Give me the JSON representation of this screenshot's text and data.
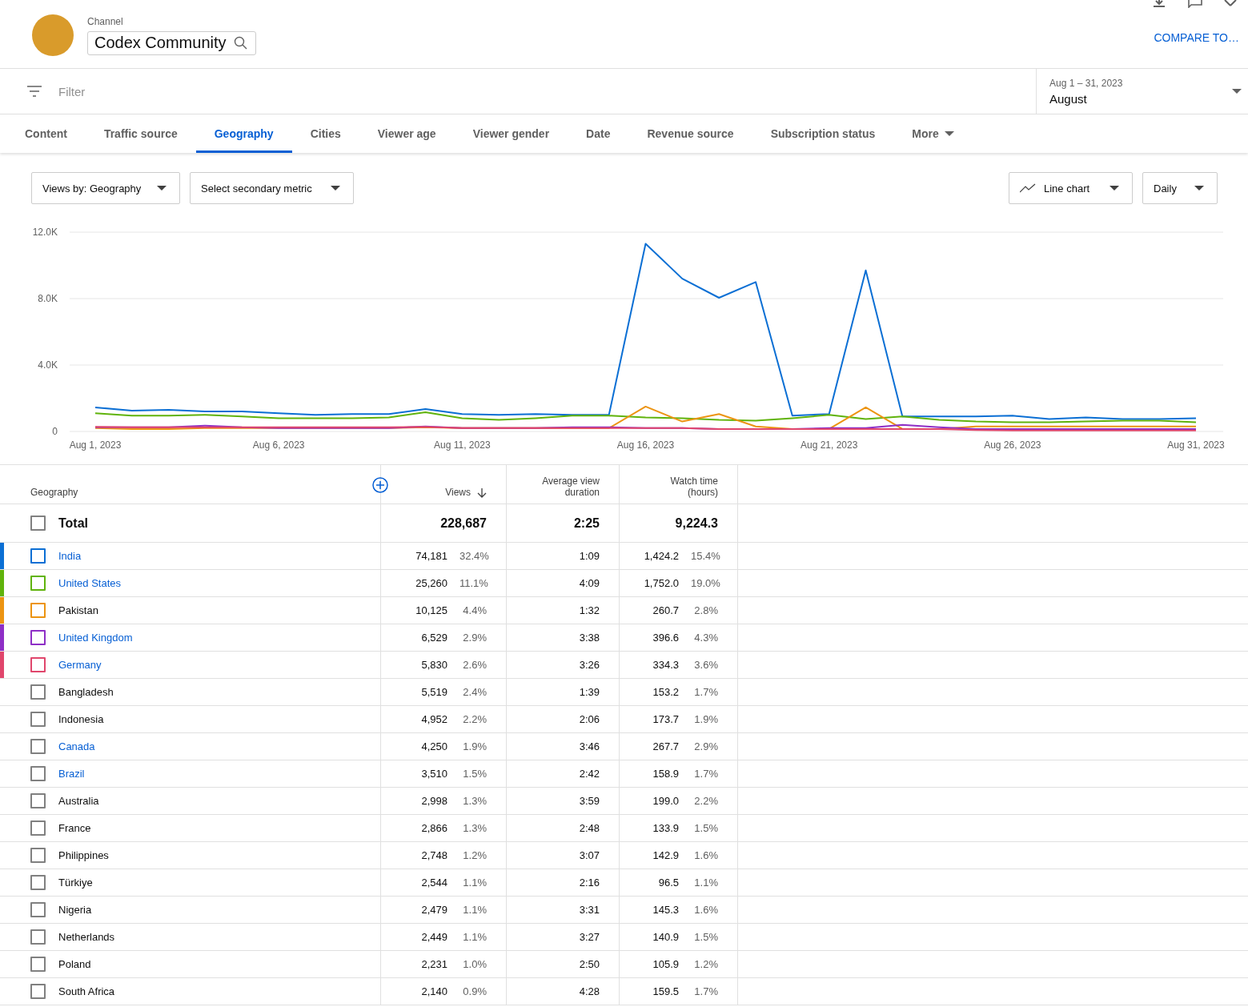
{
  "header": {
    "label": "Channel",
    "channel": "Codex Community",
    "compare": "COMPARE TO…"
  },
  "filter": {
    "placeholder": "Filter"
  },
  "date_range": {
    "range": "Aug 1 – 31, 2023",
    "period": "August"
  },
  "tabs": [
    {
      "label": "Content",
      "selected": false
    },
    {
      "label": "Traffic source",
      "selected": false
    },
    {
      "label": "Geography",
      "selected": true
    },
    {
      "label": "Cities",
      "selected": false
    },
    {
      "label": "Viewer age",
      "selected": false
    },
    {
      "label": "Viewer gender",
      "selected": false
    },
    {
      "label": "Date",
      "selected": false
    },
    {
      "label": "Revenue source",
      "selected": false
    },
    {
      "label": "Subscription status",
      "selected": false
    }
  ],
  "more": "More",
  "controls": {
    "primary": "Views by: Geography",
    "secondary": "Select secondary metric",
    "chart_type": "Line chart",
    "interval": "Daily"
  },
  "chart_data": {
    "type": "line",
    "categories": [
      "Aug 1, 2023",
      null,
      null,
      null,
      null,
      "Aug 6, 2023",
      null,
      null,
      null,
      null,
      "Aug 11, 2023",
      null,
      null,
      null,
      null,
      "Aug 16, 2023",
      null,
      null,
      null,
      null,
      "Aug 21, 2023",
      null,
      null,
      null,
      null,
      "Aug 26, 2023",
      null,
      null,
      null,
      null,
      "Aug 31, 2023"
    ],
    "ylim": [
      0,
      12000
    ],
    "yticks": [
      {
        "value": 0,
        "label": "0"
      },
      {
        "value": 4000,
        "label": "4.0K"
      },
      {
        "value": 8000,
        "label": "8.0K"
      },
      {
        "value": 12000,
        "label": "12.0K"
      }
    ],
    "series": [
      {
        "color": "#0b6fd4",
        "values": [
          1450,
          1250,
          1300,
          1200,
          1200,
          1100,
          1000,
          1050,
          1050,
          1350,
          1050,
          1000,
          1050,
          1000,
          1000,
          11300,
          9200,
          8050,
          9000,
          950,
          1050,
          9700,
          900,
          900,
          900,
          950,
          750,
          850,
          750,
          750,
          800
        ]
      },
      {
        "color": "#60b30c",
        "values": [
          1100,
          950,
          950,
          1000,
          900,
          800,
          800,
          800,
          850,
          1150,
          800,
          700,
          800,
          950,
          950,
          850,
          800,
          700,
          650,
          800,
          1000,
          750,
          900,
          700,
          600,
          550,
          550,
          600,
          650,
          650,
          550
        ]
      },
      {
        "color": "#ec9412",
        "values": [
          200,
          150,
          150,
          200,
          200,
          200,
          200,
          200,
          200,
          250,
          200,
          200,
          200,
          200,
          200,
          1500,
          600,
          1050,
          300,
          150,
          150,
          1450,
          150,
          150,
          300,
          300,
          300,
          300,
          300,
          300,
          300
        ]
      },
      {
        "color": "#8e2fc6",
        "values": [
          250,
          250,
          250,
          350,
          250,
          200,
          200,
          200,
          200,
          300,
          200,
          200,
          200,
          250,
          250,
          200,
          200,
          150,
          150,
          150,
          200,
          200,
          400,
          250,
          150,
          150,
          150,
          150,
          150,
          150,
          150
        ]
      },
      {
        "color": "#e0466c",
        "values": [
          280,
          250,
          250,
          250,
          250,
          250,
          250,
          250,
          250,
          280,
          200,
          200,
          200,
          200,
          200,
          200,
          200,
          150,
          150,
          150,
          150,
          150,
          150,
          150,
          80,
          60,
          60,
          60,
          60,
          60,
          60
        ]
      }
    ]
  },
  "table": {
    "columns": [
      {
        "label": "Geography",
        "sorted": false
      },
      {
        "label": "Views",
        "sorted": true
      },
      {
        "label": "Average view duration",
        "sorted": false
      },
      {
        "label": "Watch time (hours)",
        "sorted": false
      }
    ],
    "total": {
      "name": "Total",
      "checked": false,
      "views": "228,687",
      "avg": "2:25",
      "watch": "9,224.3"
    },
    "rows": [
      {
        "name": "India",
        "link": true,
        "checked": false,
        "color": "#0b6fd4",
        "views": "74,181",
        "views_pct": "32.4%",
        "avg": "1:09",
        "watch": "1,424.2",
        "watch_pct": "15.4%"
      },
      {
        "name": "United States",
        "link": true,
        "checked": false,
        "color": "#60b30c",
        "views": "25,260",
        "views_pct": "11.1%",
        "avg": "4:09",
        "watch": "1,752.0",
        "watch_pct": "19.0%"
      },
      {
        "name": "Pakistan",
        "link": false,
        "checked": false,
        "color": "#ec9412",
        "views": "10,125",
        "views_pct": "4.4%",
        "avg": "1:32",
        "watch": "260.7",
        "watch_pct": "2.8%"
      },
      {
        "name": "United Kingdom",
        "link": true,
        "checked": false,
        "color": "#8e2fc6",
        "views": "6,529",
        "views_pct": "2.9%",
        "avg": "3:38",
        "watch": "396.6",
        "watch_pct": "4.3%"
      },
      {
        "name": "Germany",
        "link": true,
        "checked": false,
        "color": "#e0466c",
        "views": "5,830",
        "views_pct": "2.6%",
        "avg": "3:26",
        "watch": "334.3",
        "watch_pct": "3.6%"
      },
      {
        "name": "Bangladesh",
        "link": false,
        "checked": false,
        "views": "5,519",
        "views_pct": "2.4%",
        "avg": "1:39",
        "watch": "153.2",
        "watch_pct": "1.7%"
      },
      {
        "name": "Indonesia",
        "link": false,
        "checked": false,
        "views": "4,952",
        "views_pct": "2.2%",
        "avg": "2:06",
        "watch": "173.7",
        "watch_pct": "1.9%"
      },
      {
        "name": "Canada",
        "link": true,
        "checked": false,
        "views": "4,250",
        "views_pct": "1.9%",
        "avg": "3:46",
        "watch": "267.7",
        "watch_pct": "2.9%"
      },
      {
        "name": "Brazil",
        "link": true,
        "checked": false,
        "views": "3,510",
        "views_pct": "1.5%",
        "avg": "2:42",
        "watch": "158.9",
        "watch_pct": "1.7%"
      },
      {
        "name": "Australia",
        "link": false,
        "checked": false,
        "views": "2,998",
        "views_pct": "1.3%",
        "avg": "3:59",
        "watch": "199.0",
        "watch_pct": "2.2%"
      },
      {
        "name": "France",
        "link": false,
        "checked": false,
        "views": "2,866",
        "views_pct": "1.3%",
        "avg": "2:48",
        "watch": "133.9",
        "watch_pct": "1.5%"
      },
      {
        "name": "Philippines",
        "link": false,
        "checked": false,
        "views": "2,748",
        "views_pct": "1.2%",
        "avg": "3:07",
        "watch": "142.9",
        "watch_pct": "1.6%"
      },
      {
        "name": "Türkiye",
        "link": false,
        "checked": false,
        "views": "2,544",
        "views_pct": "1.1%",
        "avg": "2:16",
        "watch": "96.5",
        "watch_pct": "1.1%"
      },
      {
        "name": "Nigeria",
        "link": false,
        "checked": false,
        "views": "2,479",
        "views_pct": "1.1%",
        "avg": "3:31",
        "watch": "145.3",
        "watch_pct": "1.6%"
      },
      {
        "name": "Netherlands",
        "link": false,
        "checked": false,
        "views": "2,449",
        "views_pct": "1.1%",
        "avg": "3:27",
        "watch": "140.9",
        "watch_pct": "1.5%"
      },
      {
        "name": "Poland",
        "link": false,
        "checked": false,
        "views": "2,231",
        "views_pct": "1.0%",
        "avg": "2:50",
        "watch": "105.9",
        "watch_pct": "1.2%"
      },
      {
        "name": "South Africa",
        "link": false,
        "checked": false,
        "views": "2,140",
        "views_pct": "0.9%",
        "avg": "4:28",
        "watch": "159.5",
        "watch_pct": "1.7%"
      }
    ]
  }
}
